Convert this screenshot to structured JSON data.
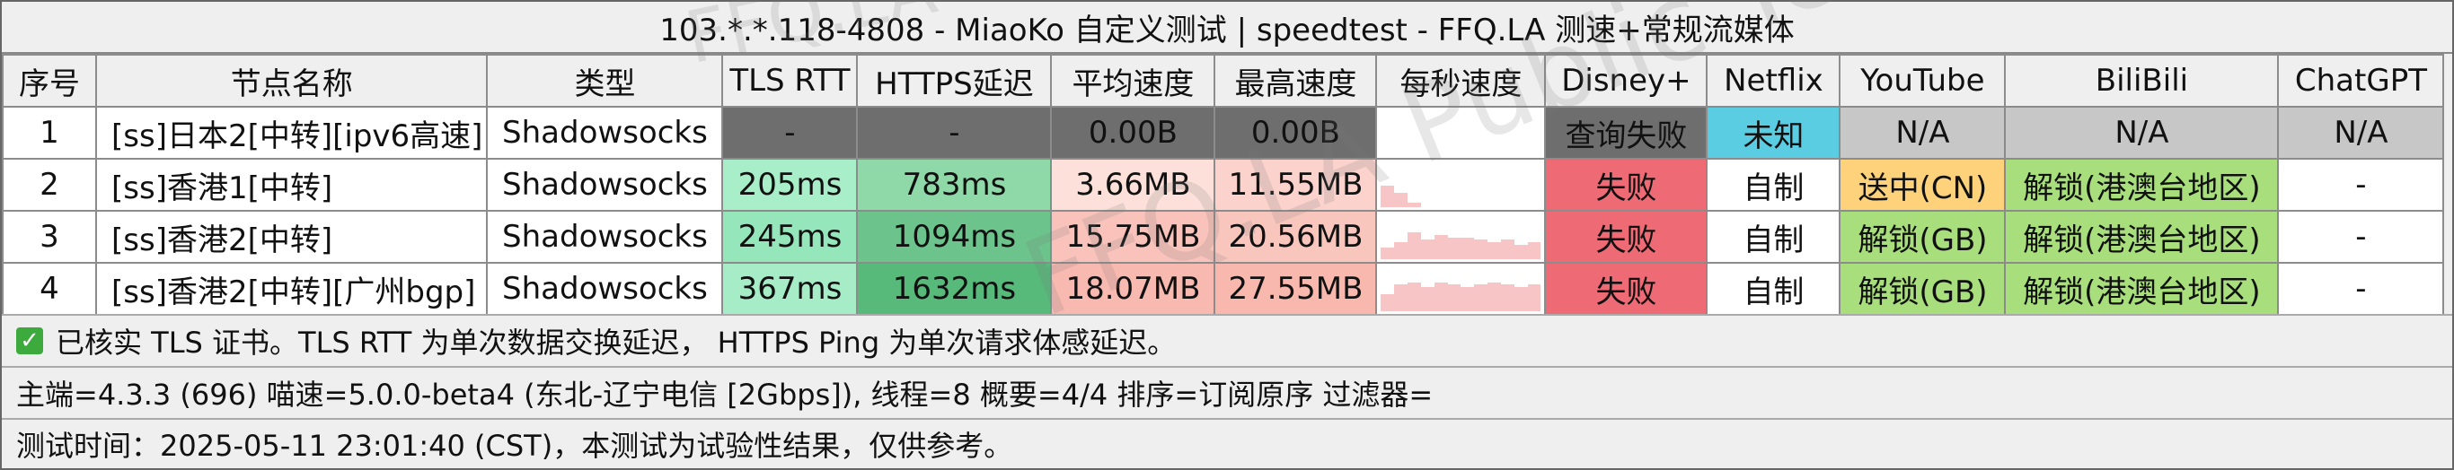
{
  "title": "103.*.*.118-4808 - MiaoKo 自定义测试 | speedtest - FFQ.LA 测速+常规流媒体",
  "headers": [
    "序号",
    "节点名称",
    "类型",
    "TLS RTT",
    "HTTPS延迟",
    "平均速度",
    "最高速度",
    "每秒速度",
    "Disney+",
    "Netflix",
    "YouTube",
    "BiliBili",
    "ChatGPT"
  ],
  "rows": [
    {
      "id": "1",
      "name": "[ss]日本2[中转][ipv6高速]",
      "type": "Shadowsocks",
      "tls": "-",
      "https": "-",
      "avg": "0.00B",
      "max": "0.00B",
      "disney": "查询失败",
      "netflix": "未知",
      "youtube": "N/A",
      "bili": "N/A",
      "gpt": "N/A"
    },
    {
      "id": "2",
      "name": "[ss]香港1[中转]",
      "type": "Shadowsocks",
      "tls": "205ms",
      "https": "783ms",
      "avg": "3.66MB",
      "max": "11.55MB",
      "disney": "失败",
      "netflix": "自制",
      "youtube": "送中(CN)",
      "bili": "解锁(港澳台地区)",
      "gpt": "-"
    },
    {
      "id": "3",
      "name": "[ss]香港2[中转]",
      "type": "Shadowsocks",
      "tls": "245ms",
      "https": "1094ms",
      "avg": "15.75MB",
      "max": "20.56MB",
      "disney": "失败",
      "netflix": "自制",
      "youtube": "解锁(GB)",
      "bili": "解锁(港澳台地区)",
      "gpt": "-"
    },
    {
      "id": "4",
      "name": "[ss]香港2[中转][广州bgp]",
      "type": "Shadowsocks",
      "tls": "367ms",
      "https": "1632ms",
      "avg": "18.07MB",
      "max": "27.55MB",
      "disney": "失败",
      "netflix": "自制",
      "youtube": "解锁(GB)",
      "bili": "解锁(港澳台地区)",
      "gpt": "-"
    }
  ],
  "footer": {
    "tls_note": "已核实 TLS 证书。TLS RTT 为单次数据交换延迟， HTTPS Ping 为单次请求体感延迟。",
    "main_info": "主端=4.3.3 (696) 喵速=5.0.0-beta4 (东北-辽宁电信 [2Gbps]), 线程=8 概要=4/4 排序=订阅原序 过滤器=",
    "test_time": "测试时间：2025-05-11 23:01:40 (CST)，本测试为试验性结果，仅供参考。"
  },
  "watermark": "FFQ.LA Public Test Center",
  "watermark_top": "FFQ.LA",
  "colors": {
    "dark_cell": "#6e6e6e",
    "tls": [
      "#a8efc9",
      "#96e6bc",
      "#a6ecc6"
    ],
    "https": [
      "#8fd8a8",
      "#6cc48c",
      "#57b97a"
    ],
    "avg": [
      "#fde0da",
      "#f9c3bb",
      "#f8b9b0"
    ],
    "max": [
      "#fbd2cc",
      "#f9c6be",
      "#f8b8ae"
    ],
    "fail": "#ee6a74",
    "unknown": "#5bcde3",
    "na": "#c7c7c7",
    "cn": "#fdd27a",
    "unlock": "#a8de7b"
  },
  "speed_samples": [
    [],
    [
      0.45,
      0.3,
      0.1,
      0,
      0,
      0,
      0,
      0,
      0,
      0,
      0,
      0
    ],
    [
      0.25,
      0.35,
      0.55,
      0.4,
      0.5,
      0.45,
      0.45,
      0.4,
      0.35,
      0.4,
      0.3,
      0.35
    ],
    [
      0.35,
      0.55,
      0.6,
      0.5,
      0.6,
      0.55,
      0.5,
      0.55,
      0.6,
      0.55,
      0.5,
      0.55
    ]
  ]
}
